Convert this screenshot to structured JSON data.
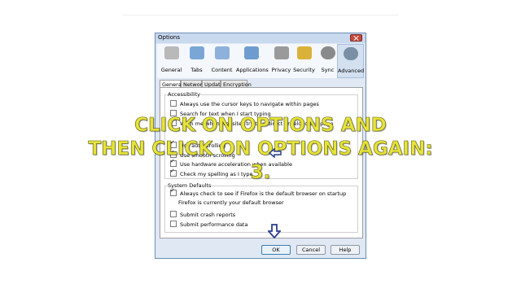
{
  "window": {
    "title": "Options"
  },
  "toolbar": {
    "items": [
      {
        "label": "General",
        "icon": "general-icon",
        "color": "#b9b9b9"
      },
      {
        "label": "Tabs",
        "icon": "tabs-icon",
        "color": "#7aa6d6"
      },
      {
        "label": "Content",
        "icon": "content-icon",
        "color": "#8db1da"
      },
      {
        "label": "Applications",
        "icon": "applications-icon",
        "color": "#6e9ccf"
      },
      {
        "label": "Privacy",
        "icon": "privacy-icon",
        "color": "#9a9a9a"
      },
      {
        "label": "Security",
        "icon": "security-icon",
        "color": "#d9b23a"
      },
      {
        "label": "Sync",
        "icon": "sync-icon",
        "color": "#8a8a8a"
      },
      {
        "label": "Advanced",
        "icon": "advanced-icon",
        "color": "#7a8fa6"
      }
    ]
  },
  "subtabs": [
    "General",
    "Network",
    "Update",
    "Encryption"
  ],
  "accessibility": {
    "legend": "Accessibility",
    "items": [
      {
        "label": "Always use the cursor keys to navigate within pages",
        "checked": false
      },
      {
        "label": "Search for text when I start typing",
        "checked": false
      },
      {
        "label": "Warn me when websites try to redirect or reload the page",
        "checked": false
      }
    ]
  },
  "browsing": {
    "items": [
      {
        "label": "Use autoscrolling",
        "checked": true
      },
      {
        "label": "Use smooth scrolling",
        "checked": true
      },
      {
        "label": "Use hardware acceleration when available",
        "checked": true
      },
      {
        "label": "Check my spelling as I type",
        "checked": true
      }
    ]
  },
  "system_defaults": {
    "legend": "System Defaults",
    "always_check": {
      "label": "Always check to see if Firefox is the default browser on startup",
      "checked": true
    },
    "status": "Firefox is currently your default browser",
    "crash": {
      "label": "Submit crash reports",
      "checked": false
    },
    "performance": {
      "label": "Submit performance data",
      "checked": false
    }
  },
  "buttons": {
    "ok": "OK",
    "cancel": "Cancel",
    "help": "Help"
  },
  "overlay": {
    "line1": "CLICK ON OPTIONS AND",
    "line2": "THEN CLICK ON OPTIONS AGAIN:",
    "line3": "3."
  },
  "colors": {
    "overlay_text": "#e6e33a",
    "arrow": "#2b3f8f",
    "ok_border": "#3c7fb1"
  }
}
